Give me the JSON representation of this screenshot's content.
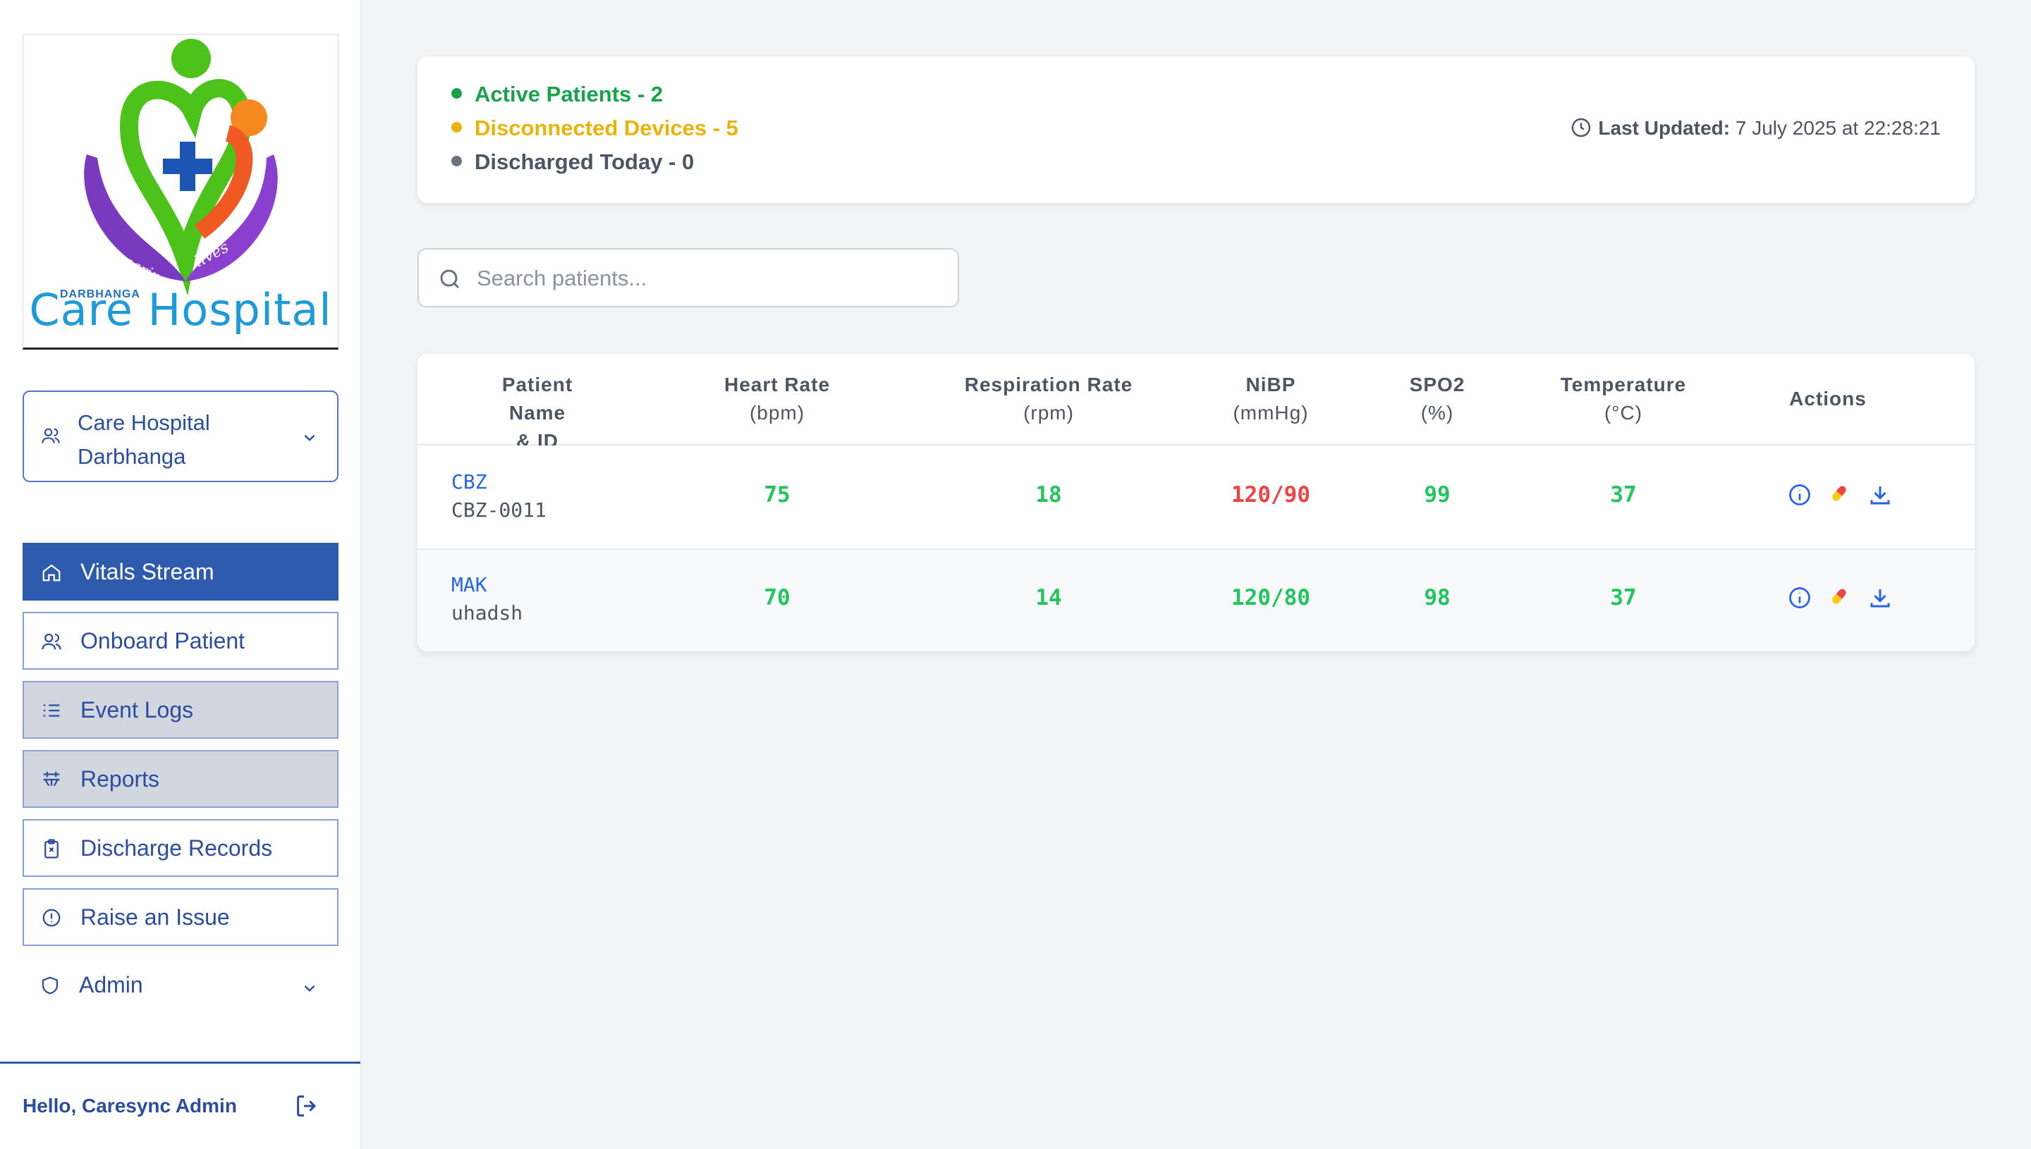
{
  "sidebar": {
    "logo": {
      "brand": "Care Hospital",
      "tagline_left": "caring",
      "tagline_right": "lives",
      "small_text": "DARBHANGA"
    },
    "hospital_select": {
      "line1": "Care Hospital",
      "line2": "Darbhanga"
    },
    "nav": [
      {
        "label": "Vitals Stream",
        "icon": "home-icon",
        "state": "active"
      },
      {
        "label": "Onboard Patient",
        "icon": "users-icon",
        "state": "normal"
      },
      {
        "label": "Event Logs",
        "icon": "list-icon",
        "state": "hover"
      },
      {
        "label": "Reports",
        "icon": "reports-icon",
        "state": "hover"
      },
      {
        "label": "Discharge Records",
        "icon": "clipboard-x-icon",
        "state": "normal"
      },
      {
        "label": "Raise an Issue",
        "icon": "alert-circle-icon",
        "state": "normal"
      },
      {
        "label": "Admin",
        "icon": "shield-icon",
        "state": "collapsible"
      }
    ],
    "footer": {
      "greeting": "Hello, Caresync Admin"
    }
  },
  "status": {
    "active": "Active Patients - 2",
    "disconnected": "Disconnected Devices - 5",
    "discharged": "Discharged Today - 0",
    "last_updated_label": "Last Updated:",
    "last_updated_value": " 7 July 2025 at 22:28:21"
  },
  "search": {
    "placeholder": "Search patients..."
  },
  "table": {
    "headers": [
      {
        "line1": "Patient Name",
        "line2": "& ID"
      },
      {
        "line1": "Heart Rate",
        "line2": "(bpm)"
      },
      {
        "line1": "Respiration Rate",
        "line2": "(rpm)"
      },
      {
        "line1": "NiBP",
        "line2": "(mmHg)"
      },
      {
        "line1": "SPO2",
        "line2": "(%)"
      },
      {
        "line1": "Temperature",
        "line2": "(°C)"
      },
      {
        "line1": "Actions",
        "line2": ""
      }
    ],
    "rows": [
      {
        "name": "CBZ",
        "id": "CBZ-0011",
        "hr": "75",
        "rr": "18",
        "nibp": "120/90",
        "spo2": "99",
        "temp": "37",
        "nibp_alert": true
      },
      {
        "name": "MAK",
        "id": "uhadsh",
        "hr": "70",
        "rr": "14",
        "nibp": "120/80",
        "spo2": "98",
        "temp": "37",
        "nibp_alert": false
      }
    ]
  },
  "colors": {
    "primary": "#2e5bad",
    "ok": "#22c55e",
    "alert": "#ef4444",
    "active_status": "#16a34a",
    "warning_status": "#eab308",
    "muted_status": "#4b5563"
  }
}
